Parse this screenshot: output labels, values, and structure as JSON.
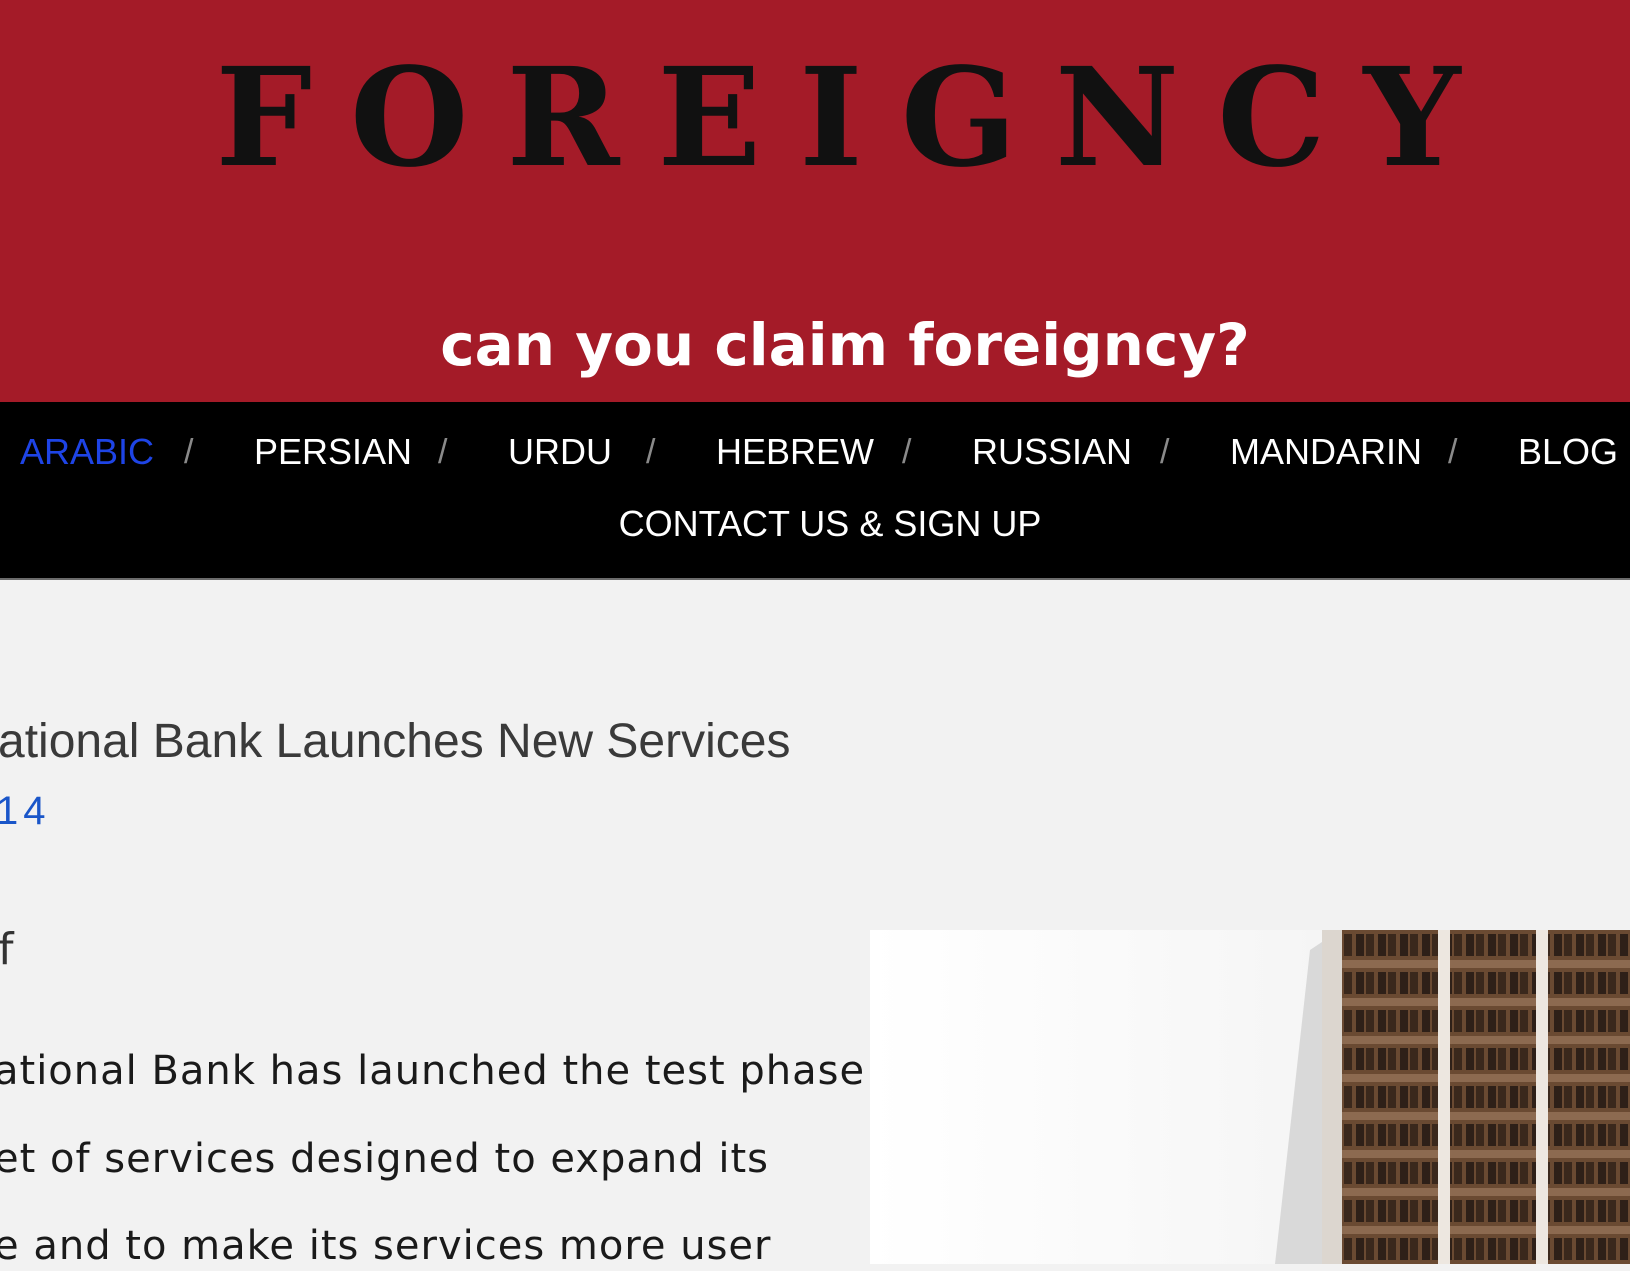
{
  "header": {
    "logo": "FOREIGNCY",
    "tagline": "can you claim foreigncy?"
  },
  "nav": {
    "items": [
      {
        "label": "ARABIC",
        "active": true
      },
      {
        "label": "PERSIAN",
        "active": false
      },
      {
        "label": "URDU",
        "active": false
      },
      {
        "label": "HEBREW",
        "active": false
      },
      {
        "label": "RUSSIAN",
        "active": false
      },
      {
        "label": "MANDARIN",
        "active": false
      },
      {
        "label": "BLOG",
        "active": false
      },
      {
        "label": "CONTACT US & SIGN UP",
        "active": false
      }
    ],
    "separator": "/"
  },
  "post": {
    "title": "ational Bank Launches New Services",
    "date": "14",
    "byline": "f",
    "paragraph_lines": [
      "ational Bank has launched the test phase",
      "et of services designed to expand its",
      "e and to make its services more user"
    ]
  },
  "colors": {
    "header_bg": "#a41b28",
    "nav_bg": "#000000",
    "active_link": "#1e44e6",
    "date_link": "#1a56c9",
    "page_bg": "#f2f2f2"
  }
}
